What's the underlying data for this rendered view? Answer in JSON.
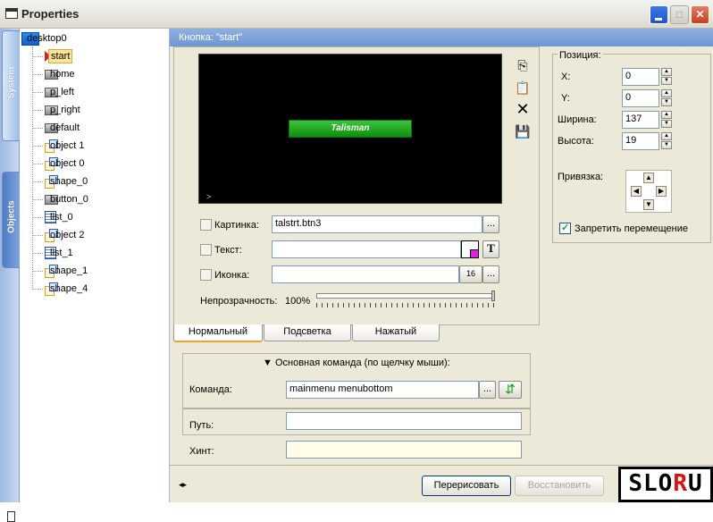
{
  "window": {
    "title": "Properties"
  },
  "left_tabs": {
    "system": "System",
    "objects": "Objects"
  },
  "tree": {
    "root": "desktop0",
    "items": [
      {
        "label": "start",
        "icon": "play-icon",
        "selected": true
      },
      {
        "label": "home",
        "icon": "button-icon"
      },
      {
        "label": "p_left",
        "icon": "button-icon"
      },
      {
        "label": "p_right",
        "icon": "button-icon"
      },
      {
        "label": "default",
        "icon": "button-icon"
      },
      {
        "label": "object 1",
        "icon": "object-icon"
      },
      {
        "label": "object 0",
        "icon": "object-icon"
      },
      {
        "label": "shape_0",
        "icon": "object-icon"
      },
      {
        "label": "button_0",
        "icon": "button-icon"
      },
      {
        "label": "list_0",
        "icon": "list-icon"
      },
      {
        "label": "object 2",
        "icon": "object-icon"
      },
      {
        "label": "list_1",
        "icon": "list-icon"
      },
      {
        "label": "shape_1",
        "icon": "object-icon"
      },
      {
        "label": "shape_4",
        "icon": "object-icon"
      }
    ]
  },
  "panel": {
    "header": "Кнопка:  \"start\"",
    "preview_button": "Talisman",
    "preview_caret": ">",
    "picture_label": "Картинка:",
    "picture_value": "talstrt.btn3",
    "text_label": "Текст:",
    "text_value": "",
    "text_format": "T",
    "icon_label": "Иконка:",
    "icon_size": "16",
    "browse": "...",
    "opacity_label": "Непрозрачность:",
    "opacity_value": "100%",
    "opacity_fraction": 1.0
  },
  "position": {
    "group": "Позиция:",
    "x_label": "X:",
    "x": "0",
    "y_label": "Y:",
    "y": "0",
    "width_label": "Ширина:",
    "width": "137",
    "height_label": "Высота:",
    "height": "19",
    "anchor_label": "Привязка:",
    "lock_label": "Запретить перемещение",
    "lock_checked": true
  },
  "tabs": [
    "Нормальный",
    "Подсветка",
    "Нажатый"
  ],
  "command": {
    "section": "Основная команда (по щелчку мыши):",
    "command_label": "Команда:",
    "command_value": "mainmenu menubottom",
    "path_label": "Путь:",
    "path_value": "",
    "hint_label": "Хинт:",
    "hint_value": ""
  },
  "footer": {
    "redraw": "Перерисовать",
    "restore": "Восстановить",
    "arrows": "◂▸"
  },
  "logo": {
    "text1": "SLO",
    "text2": "R",
    "text3": "U"
  }
}
